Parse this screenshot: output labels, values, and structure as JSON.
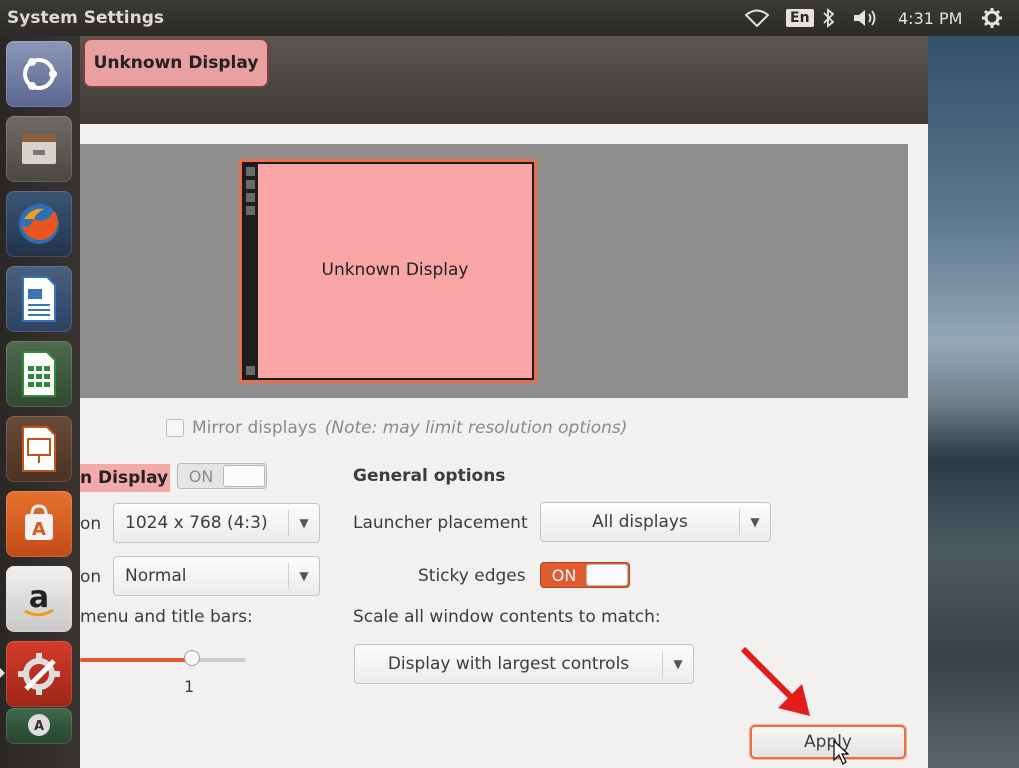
{
  "topbar": {
    "window_title": "System Settings",
    "keyboard_layout": "En",
    "clock": "4:31 PM",
    "icons": [
      "wifi-icon",
      "bluetooth-icon",
      "volume-icon",
      "settings-gear-icon"
    ]
  },
  "launcher": {
    "items": [
      "ubuntu-dash-icon",
      "files-icon",
      "firefox-icon",
      "writer-icon",
      "calc-icon",
      "impress-icon",
      "software-center-icon",
      "amazon-icon",
      "system-settings-icon",
      "workspace-switcher-icon"
    ]
  },
  "header": {
    "display_chip": "Unknown Display"
  },
  "preview": {
    "monitor_label": "Unknown Display"
  },
  "mirror": {
    "label": "Mirror displays",
    "note": "(Note: may limit resolution options)",
    "checked": false
  },
  "left_panel": {
    "display_name": "n Display",
    "display_toggle": "ON",
    "resolution_label": "on",
    "resolution_value": "1024 x 768 (4:3)",
    "rotation_label": "on",
    "rotation_value": "Normal",
    "scale_label": "menu and title bars:",
    "scale_value": "1"
  },
  "general": {
    "heading": "General options",
    "launcher_placement_label": "Launcher placement",
    "launcher_placement_value": "All displays",
    "sticky_edges_label": "Sticky edges",
    "sticky_edges_toggle": "ON",
    "scale_all_label": "Scale all window contents to match:",
    "scale_all_value": "Display with largest controls"
  },
  "actions": {
    "apply": "Apply"
  },
  "colors": {
    "accent": "#e05c30",
    "monitor_fill": "#fba6a6",
    "annotation_arrow": "#e31c1c"
  }
}
